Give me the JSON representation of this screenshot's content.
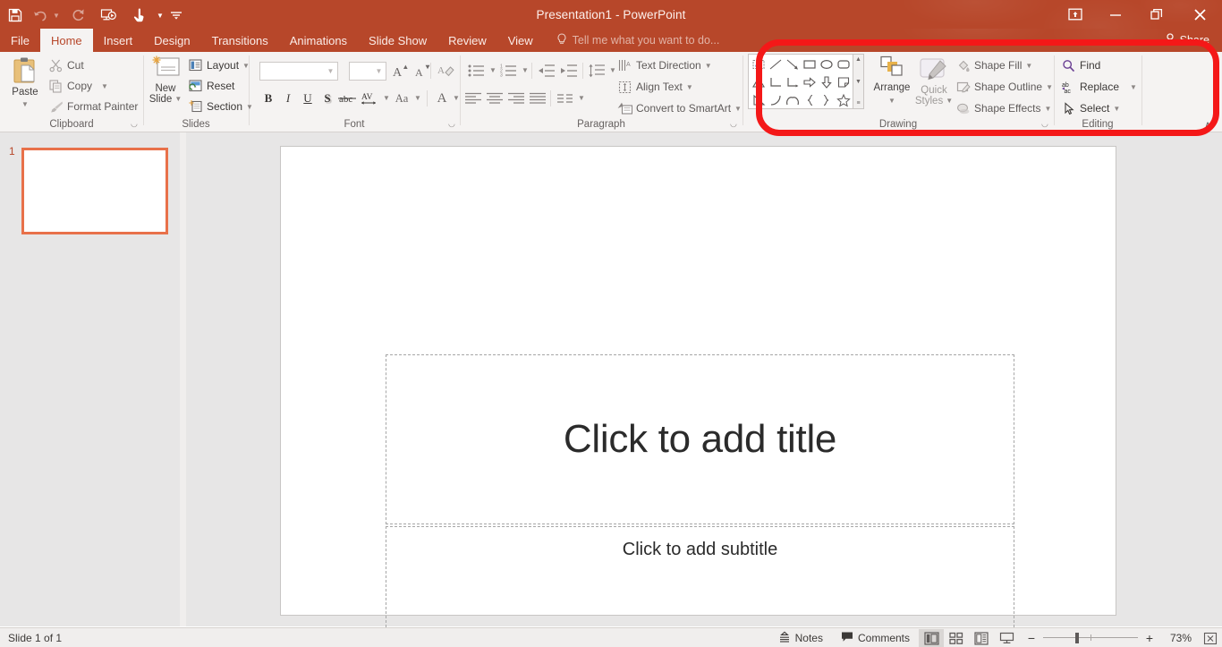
{
  "window": {
    "title": "Presentation1 - PowerPoint",
    "accent_color": "#b7472a",
    "ribbon_bg": "#f5f3f2",
    "annotation_color": "#f41818"
  },
  "quick_access": {
    "items": [
      {
        "name": "save",
        "glyph": "💾",
        "enabled": true
      },
      {
        "name": "undo",
        "glyph": "↶",
        "enabled": false,
        "has_caret": true
      },
      {
        "name": "redo",
        "glyph": "↻",
        "enabled": false,
        "has_caret": false
      },
      {
        "name": "start-from-beginning",
        "glyph": "▶",
        "enabled": true
      },
      {
        "name": "touch-mouse-mode",
        "glyph": "☝",
        "enabled": true,
        "has_caret": true
      },
      {
        "name": "customize-quick-access-toolbar",
        "glyph": "≡",
        "enabled": true
      }
    ]
  },
  "window_controls": {
    "ribbon_display_options": "⬆",
    "minimize": "—",
    "restore": "❐",
    "close": "✕"
  },
  "tabs": [
    {
      "label": "File",
      "active": false
    },
    {
      "label": "Home",
      "active": true
    },
    {
      "label": "Insert",
      "active": false
    },
    {
      "label": "Design",
      "active": false
    },
    {
      "label": "Transitions",
      "active": false
    },
    {
      "label": "Animations",
      "active": false
    },
    {
      "label": "Slide Show",
      "active": false
    },
    {
      "label": "Review",
      "active": false
    },
    {
      "label": "View",
      "active": false
    }
  ],
  "tell_me": {
    "placeholder": "Tell me what you want to do...",
    "icon": "💡"
  },
  "share": {
    "label": "Share",
    "icon": "👤"
  },
  "ribbon": {
    "groups": [
      {
        "name": "Clipboard",
        "label": "Clipboard"
      },
      {
        "name": "Slides",
        "label": "Slides"
      },
      {
        "name": "Font",
        "label": "Font"
      },
      {
        "name": "Paragraph",
        "label": "Paragraph"
      },
      {
        "name": "Drawing",
        "label": "Drawing"
      },
      {
        "name": "Editing",
        "label": "Editing"
      }
    ],
    "clipboard": {
      "paste": "Paste",
      "cut": "Cut",
      "copy": "Copy",
      "format_painter": "Format Painter"
    },
    "slides": {
      "new_slide": "New\nSlide",
      "new_slide_line1": "New",
      "new_slide_line2": "Slide",
      "layout": "Layout",
      "reset": "Reset",
      "section": "Section"
    },
    "font": {
      "font_name_value": "",
      "font_size_value": "",
      "grow_font": "A",
      "shrink_font": "A",
      "clear_formatting": "A",
      "bold": "B",
      "italic": "I",
      "underline": "U",
      "shadow": "S",
      "strikethrough": "abc",
      "character_spacing": "AV",
      "change_case": "Aa",
      "font_color": "A"
    },
    "paragraph": {
      "bullets": "•≡",
      "numbering": "1≡",
      "decrease_indent": "⇤",
      "increase_indent": "⇥",
      "line_spacing": "↕≡",
      "align_left": "≡",
      "align_center": "≡",
      "align_right": "≡",
      "justify": "≡",
      "columns": "≡",
      "text_direction": "Text Direction",
      "align_text": "Align Text",
      "convert_to_smartart": "Convert to SmartArt"
    },
    "drawing": {
      "arrange": "Arrange",
      "quick_styles_line1": "Quick",
      "quick_styles_line2": "Styles",
      "shape_fill": "Shape Fill",
      "shape_outline": "Shape Outline",
      "shape_effects": "Shape Effects",
      "shapes": [
        "textbox",
        "line",
        "arrow",
        "rectangle",
        "oval",
        "rounded-rectangle",
        "isosceles-triangle",
        "elbow-connector",
        "elbow-arrow-connector",
        "right-arrow",
        "down-arrow",
        "folded-corner",
        "right-triangle",
        "arc",
        "double-arc",
        "left-brace",
        "right-brace",
        "star"
      ],
      "scroll": {
        "up": "▲",
        "down": "▼",
        "more": "≡"
      }
    },
    "editing": {
      "find": "Find",
      "replace": "Replace",
      "select": "Select"
    },
    "collapse_ribbon": "∧"
  },
  "thumbnails": {
    "slides": [
      {
        "number": "1",
        "selected": true
      }
    ]
  },
  "slide": {
    "title_placeholder": "Click to add title",
    "subtitle_placeholder": "Click to add subtitle"
  },
  "status_bar": {
    "slide_status": "Slide 1 of 1",
    "notes": "Notes",
    "notes_icon": "☰",
    "comments": "Comments",
    "comments_icon": "💬",
    "views": [
      {
        "name": "normal-view",
        "glyph": "▤",
        "active": true
      },
      {
        "name": "slide-sorter-view",
        "glyph": "☷",
        "active": false
      },
      {
        "name": "reading-view",
        "glyph": "▥",
        "active": false
      },
      {
        "name": "slide-show-view",
        "glyph": "▭",
        "active": false
      }
    ],
    "zoom_out": "−",
    "zoom_in": "+",
    "zoom_level": "73%",
    "fit_to_window": "⤢"
  }
}
